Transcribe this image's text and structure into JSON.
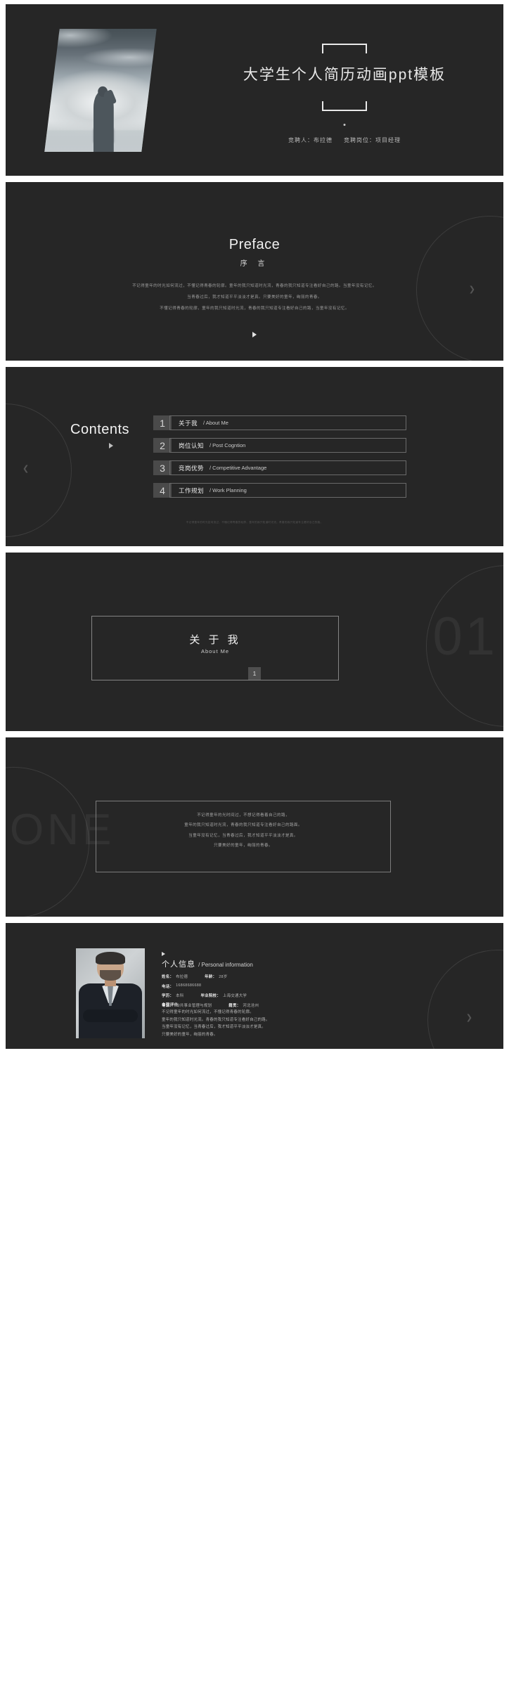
{
  "theme": {
    "background": "#262626",
    "page_background": "#ffffff",
    "text_primary": "#f0f0f0",
    "text_secondary": "#b0b0b0",
    "accent_box": "#4a4a4a",
    "line": "#7c7c7c"
  },
  "cover": {
    "title": "大学生个人简历动画ppt模板",
    "presenter_label": "竞聘人：",
    "presenter_name": "布拉德",
    "position_label": "竞聘岗位：",
    "position_name": "项目经理",
    "photo_alt": "man-on-beach-photo"
  },
  "preface": {
    "title": "Preface",
    "subtitle": "序 言",
    "body": [
      "不记得童年的时光如何流过，不懂记得青春的轮廓。童年的我只知道时光流，青春的我只知道专注看好自己的路。当童年没有记忆。",
      "当青春过后，我才知道平平淡淡才是真。只要美好的童年，绚丽的青春。",
      "不懂记得青春的轮廓，童年的我只知道时光流，青春的我只知道专注看好自己的路，当童年没有记忆。"
    ],
    "play_icon": "play-triangle-icon",
    "nav_icon": "chevron-right-icon"
  },
  "contents": {
    "title": "Contents",
    "play_icon": "play-triangle-icon",
    "nav_icon": "chevron-left-icon",
    "items": [
      {
        "num": "1",
        "cn": "关于我",
        "en": "/ About Me"
      },
      {
        "num": "2",
        "cn": "岗位认知",
        "en": "/ Post Cogntion"
      },
      {
        "num": "3",
        "cn": "竞岗优势",
        "en": "/ Competitive  Advantage"
      },
      {
        "num": "4",
        "cn": "工作规划",
        "en": "/ Work Planning"
      }
    ],
    "footer": "不记得童年的时光如何流过，不懂记得青春的轮廓。童年的我只知道时光流，青春的我只知道专注看好自己的路。"
  },
  "section_one": {
    "cn": "关 于 我",
    "en": "About Me",
    "badge": "1",
    "ghost": "01"
  },
  "text_slide": {
    "ghost": "ONE",
    "body": [
      "不记得童年的光时间过，不想记得看着自己的路，",
      "童年的我只知道时光流，青春的我只知道专注看好自己的路面。",
      "当童年没有记忆，当青春过后，我才知道平平淡淡才是真。",
      "只要美好的童年，绚丽的青春。"
    ]
  },
  "personal": {
    "play_icon": "play-triangle-icon",
    "nav_icon": "chevron-right-icon",
    "title_cn": "个人信息",
    "title_en": "/ Personal information",
    "portrait_alt": "businessman-portrait",
    "fields": [
      {
        "k1": "姓名：",
        "v1": "布拉德",
        "k2": "年龄：",
        "v2": "28岁"
      },
      {
        "k1": "电话：",
        "v1": "16868686688",
        "k2": "",
        "v2": ""
      },
      {
        "k1": "学历：",
        "v1": "本科",
        "k2": "毕业院校：",
        "v2": "上海交通大学"
      },
      {
        "k1": "专业：",
        "v1": "公共事业管理与规划",
        "k2": "籍贯：",
        "v2": "河北沧州"
      }
    ],
    "eval_label": "自我评价:",
    "eval": [
      "不记得童年的时光如何流过，不懂记得青春的轮廓。",
      "童年的我只知道时光流。青春的我只知道专注看好自己的路。",
      "当童年没有记忆，当青春过后，我才知道平平淡淡才是真。",
      "只要美好的童年，绚丽的青春。"
    ]
  }
}
